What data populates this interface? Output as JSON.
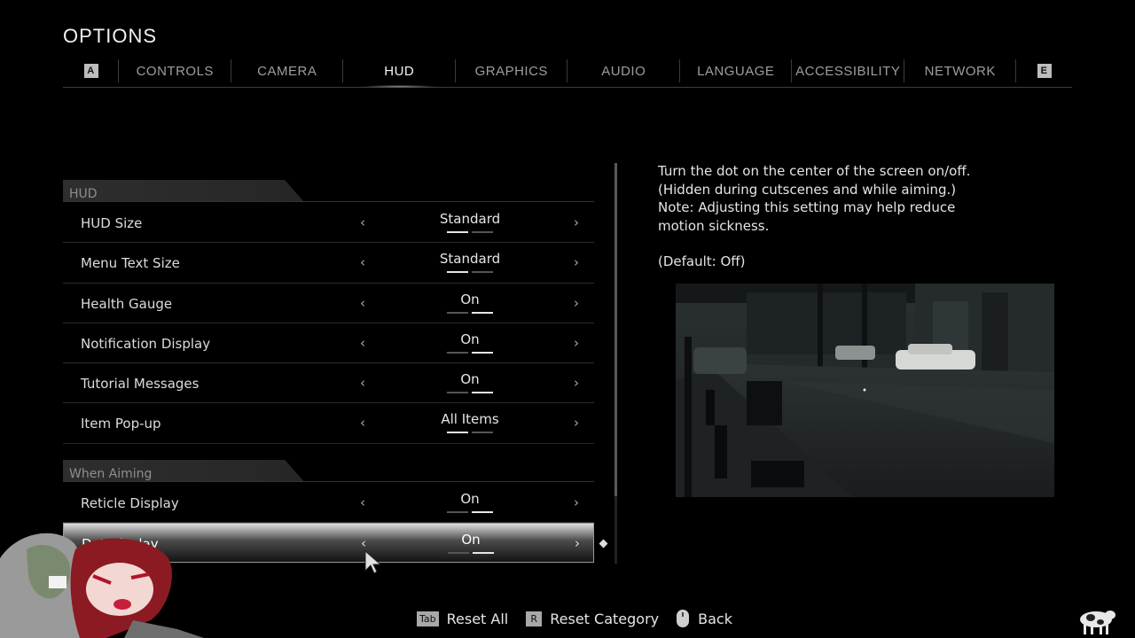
{
  "header": {
    "title": "OPTIONS"
  },
  "tabs": {
    "left_key": "A",
    "right_key": "E",
    "items": [
      {
        "label": "CONTROLS",
        "active": false
      },
      {
        "label": "CAMERA",
        "active": false
      },
      {
        "label": "HUD",
        "active": true
      },
      {
        "label": "GRAPHICS",
        "active": false
      },
      {
        "label": "AUDIO",
        "active": false
      },
      {
        "label": "LANGUAGE",
        "active": false
      },
      {
        "label": "ACCESSIBILITY",
        "active": false
      },
      {
        "label": "NETWORK",
        "active": false
      }
    ]
  },
  "sections": [
    {
      "title": "HUD",
      "rows": [
        {
          "label": "HUD Size",
          "value": "Standard",
          "option_index": 0,
          "option_count": 2
        },
        {
          "label": "Menu Text Size",
          "value": "Standard",
          "option_index": 0,
          "option_count": 2
        },
        {
          "label": "Health Gauge",
          "value": "On",
          "option_index": 1,
          "option_count": 2
        },
        {
          "label": "Notification Display",
          "value": "On",
          "option_index": 1,
          "option_count": 2
        },
        {
          "label": "Tutorial Messages",
          "value": "On",
          "option_index": 1,
          "option_count": 2
        },
        {
          "label": "Item Pop-up",
          "value": "All Items",
          "option_index": 0,
          "option_count": 2
        }
      ]
    },
    {
      "title": "When Aiming",
      "rows": [
        {
          "label": "Reticle Display",
          "value": "On",
          "option_index": 1,
          "option_count": 2
        },
        {
          "label": "Dot Display",
          "value": "On",
          "option_index": 1,
          "option_count": 2,
          "selected": true
        }
      ]
    }
  ],
  "description": {
    "lines": [
      "Turn the dot on the center of the screen on/off.",
      "(Hidden during cutscenes and while aiming.)",
      "Note: Adjusting this setting may help reduce",
      "motion sickness."
    ],
    "default_text": "(Default: Off)"
  },
  "footer": {
    "reset_all_key": "Tab",
    "reset_all_label": "Reset All",
    "reset_category_key": "R",
    "reset_category_label": "Reset Category",
    "back_icon": "mouse-icon",
    "back_label": "Back"
  },
  "arrows": {
    "left": "‹",
    "right": "›"
  },
  "colors": {
    "accent": "#f4f4f4",
    "background": "#000000",
    "selected_row": "#dcdcdc"
  }
}
